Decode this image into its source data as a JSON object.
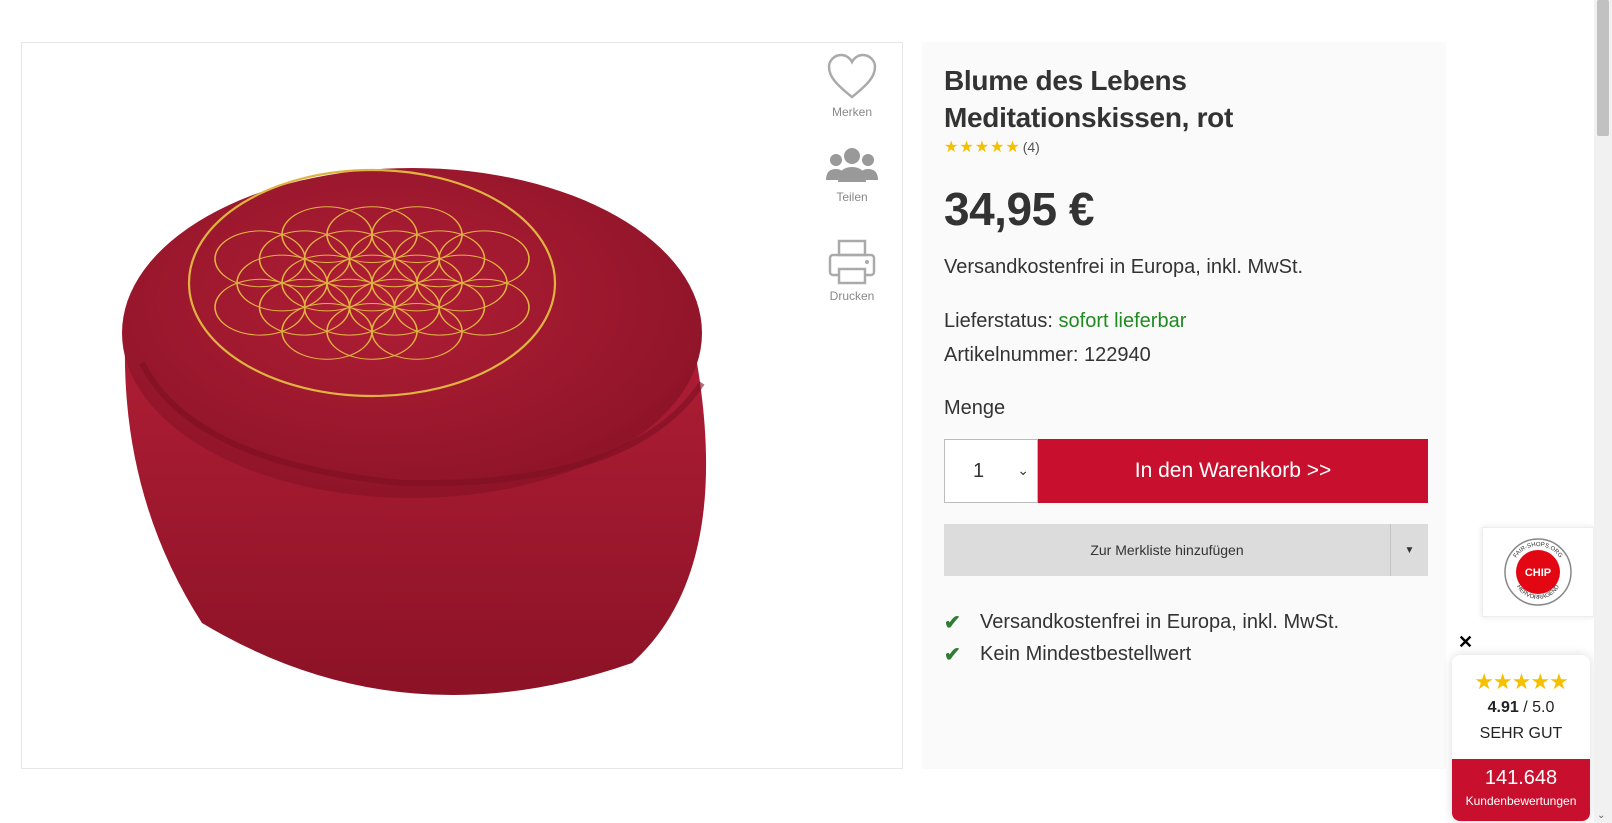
{
  "product": {
    "title": "Blume des Lebens Meditationskissen, rot",
    "rating_stars": "★★★★★",
    "rating_count": "(4)",
    "price": "34,95 €",
    "shipping_note": "Versandkostenfrei in Europa, inkl. MwSt.",
    "status_label": "Lieferstatus:",
    "status_value": "sofort lieferbar",
    "article_label": "Artikelnummer:",
    "article_number": "122940",
    "quantity_label": "Menge",
    "quantity_value": "1",
    "add_to_cart": "In den Warenkorb >>",
    "add_to_wishlist": "Zur Merkliste hinzufügen",
    "usps": [
      "Versandkostenfrei in Europa, inkl. MwSt.",
      "Kein Mindestbestellwert"
    ]
  },
  "side_actions": [
    {
      "label": "Merken",
      "icon": "heart-icon"
    },
    {
      "label": "Teilen",
      "icon": "users-icon"
    },
    {
      "label": "Drucken",
      "icon": "printer-icon"
    }
  ],
  "seal": {
    "brand": "CHIP",
    "ring_text": "FAIR-SHOPS.ORG HERVORRAGEND"
  },
  "review_widget": {
    "stars": "★★★★★",
    "score": "4.91",
    "score_max": "/ 5.0",
    "grade": "SEHR GUT",
    "count": "141.648",
    "count_label": "Kundenbewertungen",
    "close": "✕"
  },
  "colors": {
    "accent": "#c8102e",
    "success": "#1f8a1f",
    "star": "#f5c000",
    "cushion": "#a3182f",
    "embroidery": "#e0b341"
  }
}
